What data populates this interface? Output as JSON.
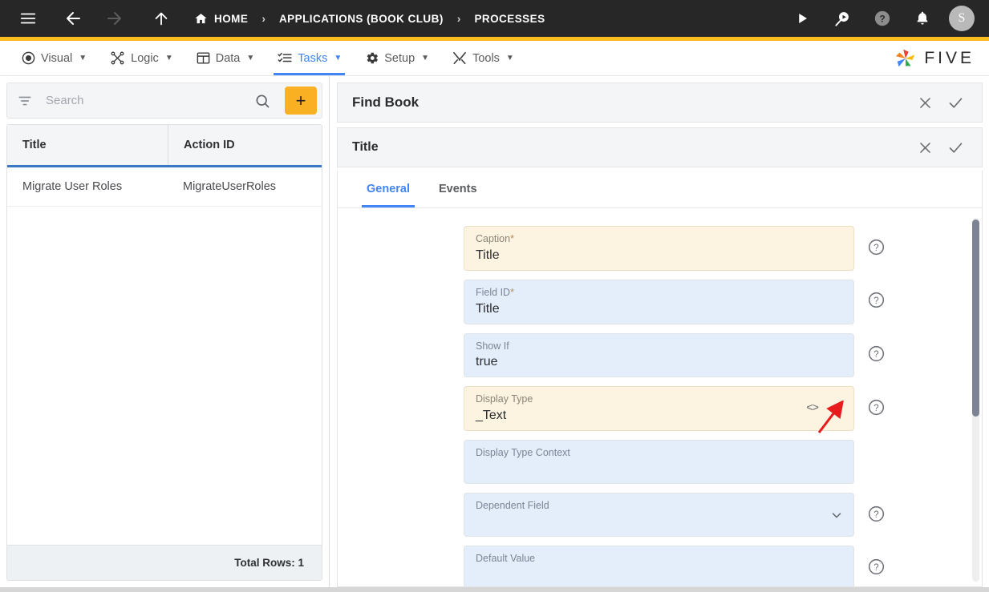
{
  "topbar": {
    "menu_icon": "hamburger-menu-icon",
    "back_icon": "arrow-left-icon",
    "forward_icon": "arrow-right-icon",
    "up_icon": "arrow-up-icon",
    "home_icon": "home-icon",
    "breadcrumbs": [
      {
        "label": "HOME",
        "icon": "home-icon"
      },
      {
        "label": "APPLICATIONS (BOOK CLUB)",
        "icon": ""
      },
      {
        "label": "PROCESSES",
        "icon": ""
      }
    ],
    "separator": "›",
    "actions": [
      {
        "name": "run-button",
        "icon": "play-icon"
      },
      {
        "name": "search-run-button",
        "icon": "search-play-icon"
      },
      {
        "name": "help-button",
        "icon": "question-circle-icon"
      },
      {
        "name": "notifications-button",
        "icon": "bell-icon"
      }
    ],
    "avatar_initial": "S",
    "accent_color": "#FBBC1F",
    "background": "#272727"
  },
  "menubar": {
    "items": [
      {
        "label": "Visual",
        "icon": "eye-icon",
        "active": false
      },
      {
        "label": "Logic",
        "icon": "flow-nodes-icon",
        "active": false
      },
      {
        "label": "Data",
        "icon": "table-grid-icon",
        "active": false
      },
      {
        "label": "Tasks",
        "icon": "checklist-icon",
        "active": true
      },
      {
        "label": "Setup",
        "icon": "gear-icon",
        "active": false
      },
      {
        "label": "Tools",
        "icon": "wrench-screwdriver-icon",
        "active": false
      }
    ],
    "caret": "▼",
    "brand": "FIVE",
    "active_color": "#4285F4"
  },
  "left_panel": {
    "filter_icon": "filter-funnel-icon",
    "search_placeholder": "Search",
    "search_value": "",
    "search_icon": "magnifier-icon",
    "add_label": "+",
    "add_color": "#F9B123",
    "columns": [
      "Title",
      "Action ID"
    ],
    "rows": [
      {
        "title": "Migrate User Roles",
        "action_id": "MigrateUserRoles"
      }
    ],
    "footer": "Total Rows: 1"
  },
  "right_panel": {
    "outer_header": {
      "title": "Find Book",
      "close_icon": "close-x-icon",
      "confirm_icon": "checkmark-icon"
    },
    "inner_header": {
      "title": "Title",
      "close_icon": "close-x-icon",
      "confirm_icon": "checkmark-icon"
    },
    "tabs": [
      {
        "label": "General",
        "active": true
      },
      {
        "label": "Events",
        "active": false
      }
    ],
    "fields": [
      {
        "label": "Caption",
        "required": true,
        "value": "Title",
        "state": "modified",
        "has_help": true,
        "has_dropdown": false,
        "has_code": false
      },
      {
        "label": "Field ID",
        "required": true,
        "value": "Title",
        "state": "normal",
        "has_help": true,
        "has_dropdown": false,
        "has_code": false
      },
      {
        "label": "Show If",
        "required": false,
        "value": "true",
        "state": "normal",
        "has_help": true,
        "has_dropdown": false,
        "has_code": false
      },
      {
        "label": "Display Type",
        "required": false,
        "value": "_Text",
        "state": "modified",
        "has_help": true,
        "has_dropdown": true,
        "has_code": true
      },
      {
        "label": "Display Type Context",
        "required": false,
        "value": "",
        "state": "normal",
        "has_help": false,
        "has_dropdown": false,
        "has_code": false
      },
      {
        "label": "Dependent Field",
        "required": false,
        "value": "",
        "state": "normal",
        "has_help": true,
        "has_dropdown": true,
        "has_code": false
      },
      {
        "label": "Default Value",
        "required": false,
        "value": "",
        "state": "normal",
        "has_help": true,
        "has_dropdown": false,
        "has_code": false
      }
    ],
    "required_marker": "*",
    "help_icon": "question-circle-icon",
    "dropdown_icon": "chevron-down-icon",
    "code_icon": "code-brackets-icon"
  },
  "annotation": {
    "type": "arrow",
    "color": "#E81C1C",
    "points_at": "display-type-dropdown-chevron"
  }
}
